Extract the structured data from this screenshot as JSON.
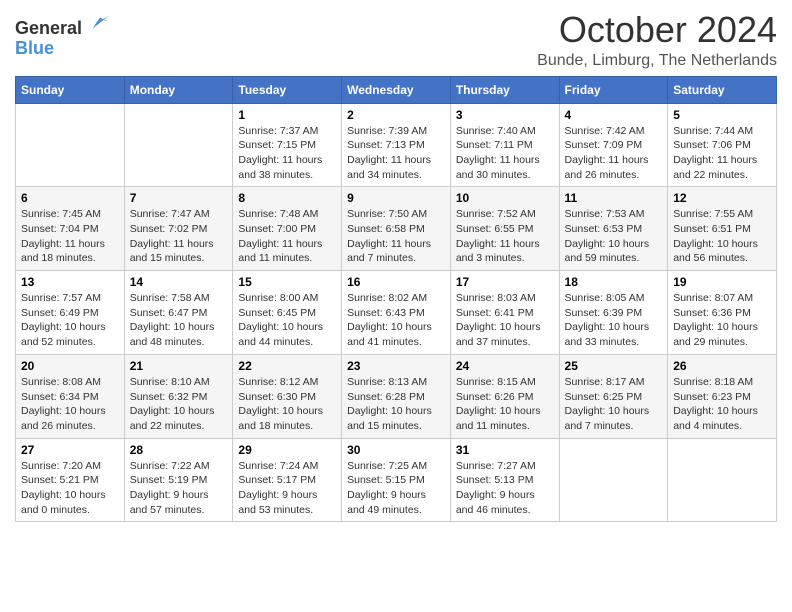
{
  "header": {
    "logo": {
      "general": "General",
      "blue": "Blue"
    },
    "title": "October 2024",
    "location": "Bunde, Limburg, The Netherlands"
  },
  "weekdays": [
    "Sunday",
    "Monday",
    "Tuesday",
    "Wednesday",
    "Thursday",
    "Friday",
    "Saturday"
  ],
  "weeks": [
    [
      {
        "day": "",
        "info": ""
      },
      {
        "day": "",
        "info": ""
      },
      {
        "day": "1",
        "info": "Sunrise: 7:37 AM\nSunset: 7:15 PM\nDaylight: 11 hours\nand 38 minutes."
      },
      {
        "day": "2",
        "info": "Sunrise: 7:39 AM\nSunset: 7:13 PM\nDaylight: 11 hours\nand 34 minutes."
      },
      {
        "day": "3",
        "info": "Sunrise: 7:40 AM\nSunset: 7:11 PM\nDaylight: 11 hours\nand 30 minutes."
      },
      {
        "day": "4",
        "info": "Sunrise: 7:42 AM\nSunset: 7:09 PM\nDaylight: 11 hours\nand 26 minutes."
      },
      {
        "day": "5",
        "info": "Sunrise: 7:44 AM\nSunset: 7:06 PM\nDaylight: 11 hours\nand 22 minutes."
      }
    ],
    [
      {
        "day": "6",
        "info": "Sunrise: 7:45 AM\nSunset: 7:04 PM\nDaylight: 11 hours\nand 18 minutes."
      },
      {
        "day": "7",
        "info": "Sunrise: 7:47 AM\nSunset: 7:02 PM\nDaylight: 11 hours\nand 15 minutes."
      },
      {
        "day": "8",
        "info": "Sunrise: 7:48 AM\nSunset: 7:00 PM\nDaylight: 11 hours\nand 11 minutes."
      },
      {
        "day": "9",
        "info": "Sunrise: 7:50 AM\nSunset: 6:58 PM\nDaylight: 11 hours\nand 7 minutes."
      },
      {
        "day": "10",
        "info": "Sunrise: 7:52 AM\nSunset: 6:55 PM\nDaylight: 11 hours\nand 3 minutes."
      },
      {
        "day": "11",
        "info": "Sunrise: 7:53 AM\nSunset: 6:53 PM\nDaylight: 10 hours\nand 59 minutes."
      },
      {
        "day": "12",
        "info": "Sunrise: 7:55 AM\nSunset: 6:51 PM\nDaylight: 10 hours\nand 56 minutes."
      }
    ],
    [
      {
        "day": "13",
        "info": "Sunrise: 7:57 AM\nSunset: 6:49 PM\nDaylight: 10 hours\nand 52 minutes."
      },
      {
        "day": "14",
        "info": "Sunrise: 7:58 AM\nSunset: 6:47 PM\nDaylight: 10 hours\nand 48 minutes."
      },
      {
        "day": "15",
        "info": "Sunrise: 8:00 AM\nSunset: 6:45 PM\nDaylight: 10 hours\nand 44 minutes."
      },
      {
        "day": "16",
        "info": "Sunrise: 8:02 AM\nSunset: 6:43 PM\nDaylight: 10 hours\nand 41 minutes."
      },
      {
        "day": "17",
        "info": "Sunrise: 8:03 AM\nSunset: 6:41 PM\nDaylight: 10 hours\nand 37 minutes."
      },
      {
        "day": "18",
        "info": "Sunrise: 8:05 AM\nSunset: 6:39 PM\nDaylight: 10 hours\nand 33 minutes."
      },
      {
        "day": "19",
        "info": "Sunrise: 8:07 AM\nSunset: 6:36 PM\nDaylight: 10 hours\nand 29 minutes."
      }
    ],
    [
      {
        "day": "20",
        "info": "Sunrise: 8:08 AM\nSunset: 6:34 PM\nDaylight: 10 hours\nand 26 minutes."
      },
      {
        "day": "21",
        "info": "Sunrise: 8:10 AM\nSunset: 6:32 PM\nDaylight: 10 hours\nand 22 minutes."
      },
      {
        "day": "22",
        "info": "Sunrise: 8:12 AM\nSunset: 6:30 PM\nDaylight: 10 hours\nand 18 minutes."
      },
      {
        "day": "23",
        "info": "Sunrise: 8:13 AM\nSunset: 6:28 PM\nDaylight: 10 hours\nand 15 minutes."
      },
      {
        "day": "24",
        "info": "Sunrise: 8:15 AM\nSunset: 6:26 PM\nDaylight: 10 hours\nand 11 minutes."
      },
      {
        "day": "25",
        "info": "Sunrise: 8:17 AM\nSunset: 6:25 PM\nDaylight: 10 hours\nand 7 minutes."
      },
      {
        "day": "26",
        "info": "Sunrise: 8:18 AM\nSunset: 6:23 PM\nDaylight: 10 hours\nand 4 minutes."
      }
    ],
    [
      {
        "day": "27",
        "info": "Sunrise: 7:20 AM\nSunset: 5:21 PM\nDaylight: 10 hours\nand 0 minutes."
      },
      {
        "day": "28",
        "info": "Sunrise: 7:22 AM\nSunset: 5:19 PM\nDaylight: 9 hours\nand 57 minutes."
      },
      {
        "day": "29",
        "info": "Sunrise: 7:24 AM\nSunset: 5:17 PM\nDaylight: 9 hours\nand 53 minutes."
      },
      {
        "day": "30",
        "info": "Sunrise: 7:25 AM\nSunset: 5:15 PM\nDaylight: 9 hours\nand 49 minutes."
      },
      {
        "day": "31",
        "info": "Sunrise: 7:27 AM\nSunset: 5:13 PM\nDaylight: 9 hours\nand 46 minutes."
      },
      {
        "day": "",
        "info": ""
      },
      {
        "day": "",
        "info": ""
      }
    ]
  ]
}
